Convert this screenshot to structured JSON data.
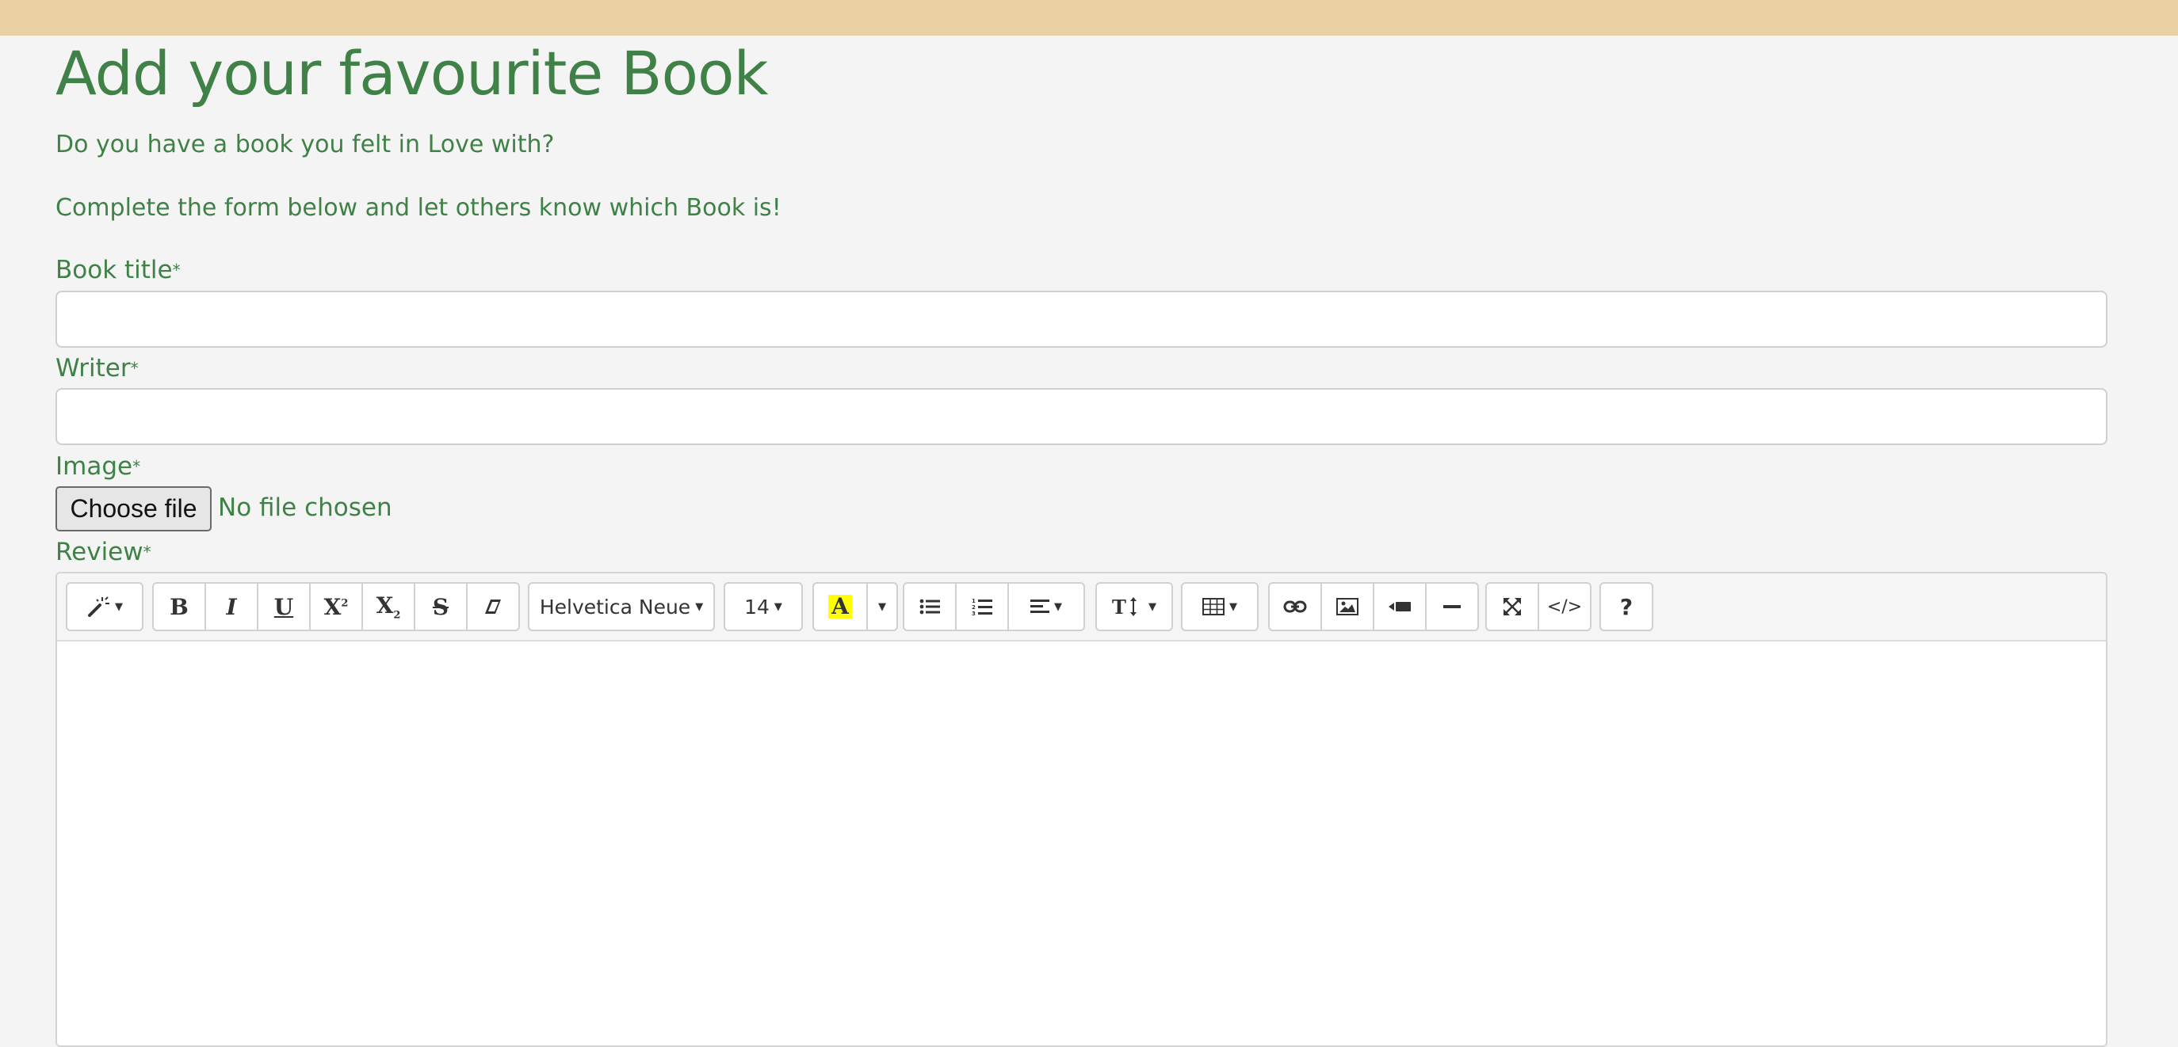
{
  "page": {
    "title": "Add your favourite Book",
    "intro_line1": "Do you have a book you felt in Love with?",
    "intro_line2": "Complete the form below and let others know which Book is!"
  },
  "colors": {
    "topbar": "#e8d0a3",
    "accent_green": "#3f8147",
    "background": "#f4f4f4"
  },
  "form": {
    "required_marker": "*",
    "book_title": {
      "label": "Book title",
      "value": ""
    },
    "writer": {
      "label": "Writer",
      "value": ""
    },
    "image": {
      "label": "Image",
      "button_label": "Choose file",
      "status": "No file chosen"
    },
    "review": {
      "label": "Review"
    }
  },
  "editor": {
    "toolbar": {
      "style_icon": "magic-wand-icon",
      "bold": "B",
      "italic": "I",
      "underline": "U",
      "superscript_icon": "superscript-icon",
      "subscript_icon": "subscript-icon",
      "strikethrough": "S",
      "clear_format_icon": "eraser-icon",
      "font_family": "Helvetica Neue",
      "font_size": "14",
      "color_letter": "A",
      "unordered_list_icon": "bullet-list-icon",
      "ordered_list_icon": "numbered-list-icon",
      "paragraph_icon": "align-left-icon",
      "line_height_icon": "text-height-icon",
      "table_icon": "table-icon",
      "link_icon": "link-icon",
      "picture_icon": "picture-icon",
      "video_icon": "video-icon",
      "hr_icon": "horizontal-rule-icon",
      "fullscreen_icon": "fullscreen-icon",
      "codeview": "</>",
      "help": "?"
    },
    "content": ""
  }
}
